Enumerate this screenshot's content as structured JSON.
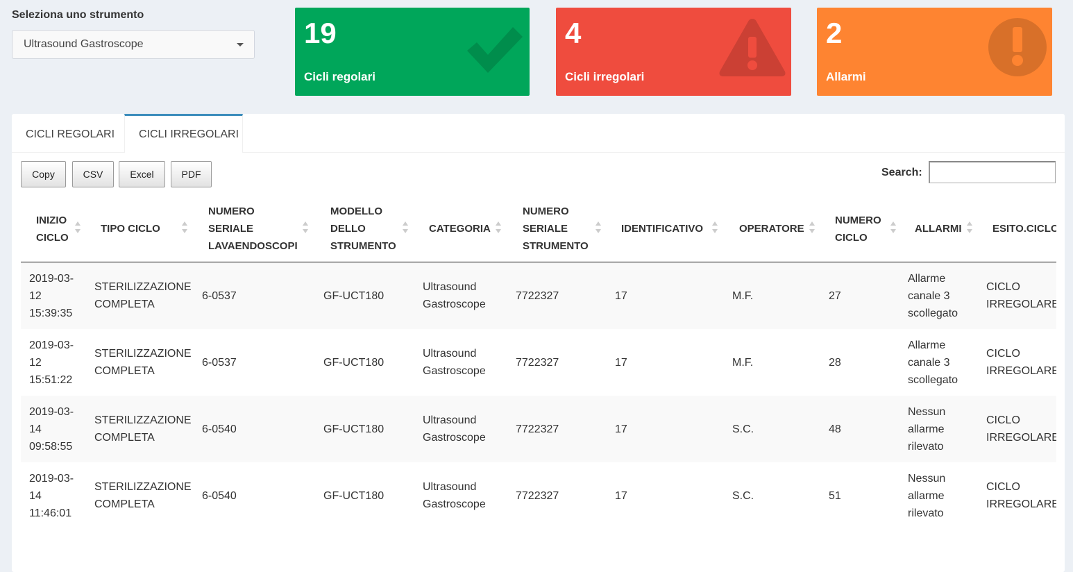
{
  "selector": {
    "label": "Seleziona uno strumento",
    "value": "Ultrasound Gastroscope"
  },
  "value_boxes": [
    {
      "number": "19",
      "label": "Cicli regolari",
      "color": "#00a65a",
      "icon": "check-icon"
    },
    {
      "number": "4",
      "label": "Cicli irregolari",
      "color": "#ef4c3e",
      "icon": "warning-icon"
    },
    {
      "number": "2",
      "label": "Allarmi",
      "color": "#fe8431",
      "icon": "exclamation-circle-icon"
    }
  ],
  "tabs": [
    {
      "label": "CICLI REGOLARI",
      "active": false
    },
    {
      "label": "CICLI IRREGOLARI",
      "active": true
    }
  ],
  "toolbar": {
    "copy": "Copy",
    "csv": "CSV",
    "excel": "Excel",
    "pdf": "PDF",
    "search_label": "Search:",
    "search_value": ""
  },
  "table": {
    "columns": [
      [
        "INIZIO",
        "CICLO"
      ],
      [
        "TIPO CICLO"
      ],
      [
        "NUMERO",
        "SERIALE",
        "LAVAENDOSCOPI"
      ],
      [
        "MODELLO",
        "DELLO",
        "STRUMENTO"
      ],
      [
        "CATEGORIA"
      ],
      [
        "NUMERO",
        "SERIALE",
        "STRUMENTO"
      ],
      [
        "IDENTIFICATIVO"
      ],
      [
        "OPERATORE"
      ],
      [
        "NUMERO",
        "CICLO"
      ],
      [
        "ALLARMI"
      ],
      [
        "ESITO.CICLO"
      ]
    ],
    "rows": [
      [
        [
          "2019-03-",
          "12",
          "15:39:35"
        ],
        [
          "STERILIZZAZIONE",
          "COMPLETA"
        ],
        [
          "6-0537"
        ],
        [
          "GF-UCT180"
        ],
        [
          "Ultrasound",
          "Gastroscope"
        ],
        [
          "7722327"
        ],
        [
          "17"
        ],
        [
          "M.F."
        ],
        [
          "27"
        ],
        [
          "Allarme",
          "canale 3",
          "scollegato"
        ],
        [
          "CICLO",
          "IRREGOLARE"
        ]
      ],
      [
        [
          "2019-03-",
          "12",
          "15:51:22"
        ],
        [
          "STERILIZZAZIONE",
          "COMPLETA"
        ],
        [
          "6-0537"
        ],
        [
          "GF-UCT180"
        ],
        [
          "Ultrasound",
          "Gastroscope"
        ],
        [
          "7722327"
        ],
        [
          "17"
        ],
        [
          "M.F."
        ],
        [
          "28"
        ],
        [
          "Allarme",
          "canale 3",
          "scollegato"
        ],
        [
          "CICLO",
          "IRREGOLARE"
        ]
      ],
      [
        [
          "2019-03-",
          "14",
          "09:58:55"
        ],
        [
          "STERILIZZAZIONE",
          "COMPLETA"
        ],
        [
          "6-0540"
        ],
        [
          "GF-UCT180"
        ],
        [
          "Ultrasound",
          "Gastroscope"
        ],
        [
          "7722327"
        ],
        [
          "17"
        ],
        [
          "S.C."
        ],
        [
          "48"
        ],
        [
          "Nessun",
          "allarme",
          "rilevato"
        ],
        [
          "CICLO",
          "IRREGOLARE"
        ]
      ],
      [
        [
          "2019-03-",
          "14",
          "11:46:01"
        ],
        [
          "STERILIZZAZIONE",
          "COMPLETA"
        ],
        [
          "6-0540"
        ],
        [
          "GF-UCT180"
        ],
        [
          "Ultrasound",
          "Gastroscope"
        ],
        [
          "7722327"
        ],
        [
          "17"
        ],
        [
          "S.C."
        ],
        [
          "51"
        ],
        [
          "Nessun",
          "allarme",
          "rilevato"
        ],
        [
          "CICLO",
          "IRREGOLARE"
        ]
      ]
    ]
  }
}
